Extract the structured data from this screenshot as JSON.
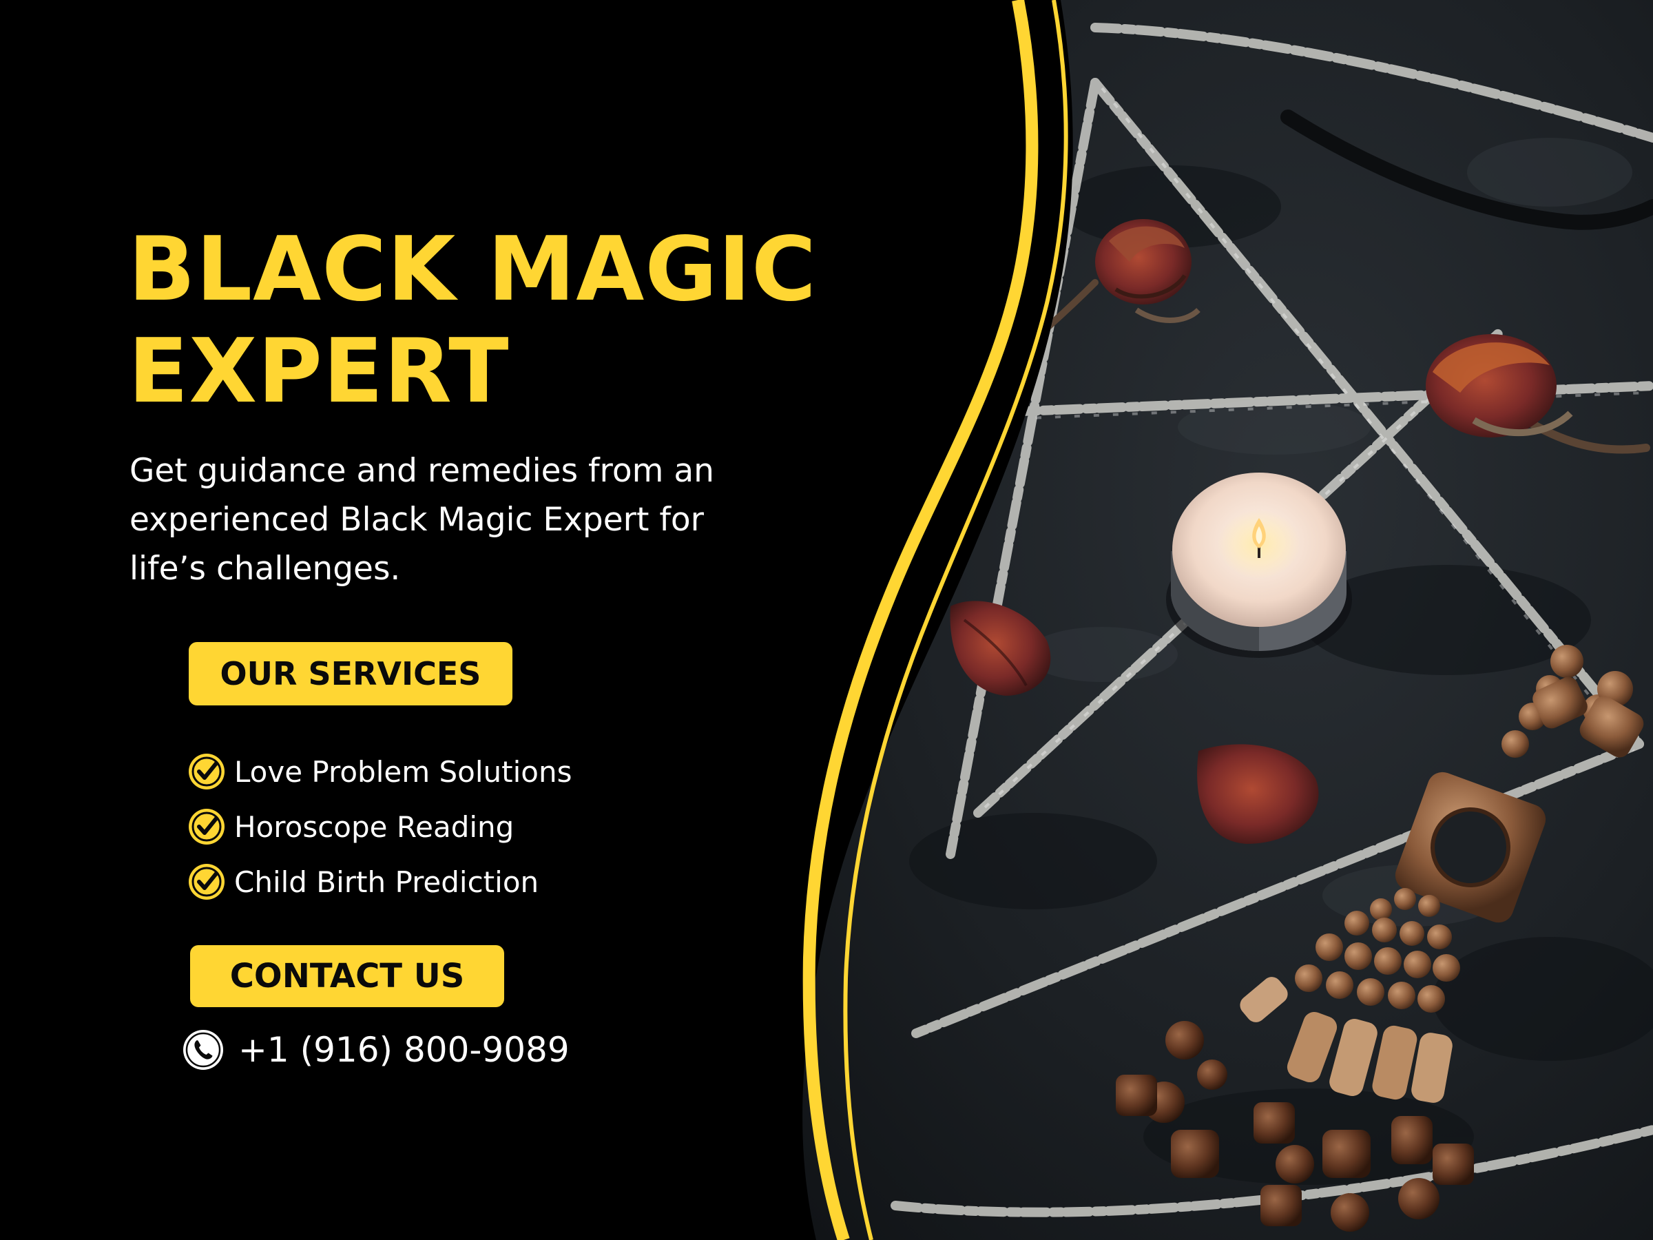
{
  "headline": {
    "line1": "BLACK MAGIC",
    "line2": "EXPERT"
  },
  "subtitle": "Get guidance and remedies from an experienced Black Magic Expert for life’s challenges.",
  "services": {
    "button_label": "OUR SERVICES",
    "items": [
      {
        "label": "Love Problem Solutions",
        "icon": "check-circle-icon"
      },
      {
        "label": "Horoscope Reading",
        "icon": "check-circle-icon"
      },
      {
        "label": "Child Birth Prediction",
        "icon": "check-circle-icon"
      }
    ]
  },
  "contact": {
    "button_label": "CONTACT US",
    "phone": "+1 (916) 800-9089",
    "phone_icon": "phone-icon"
  },
  "colors": {
    "accent": "#FFD633",
    "background": "#000000",
    "photo_background": "#1e2226",
    "text": "#FFFFFF"
  }
}
